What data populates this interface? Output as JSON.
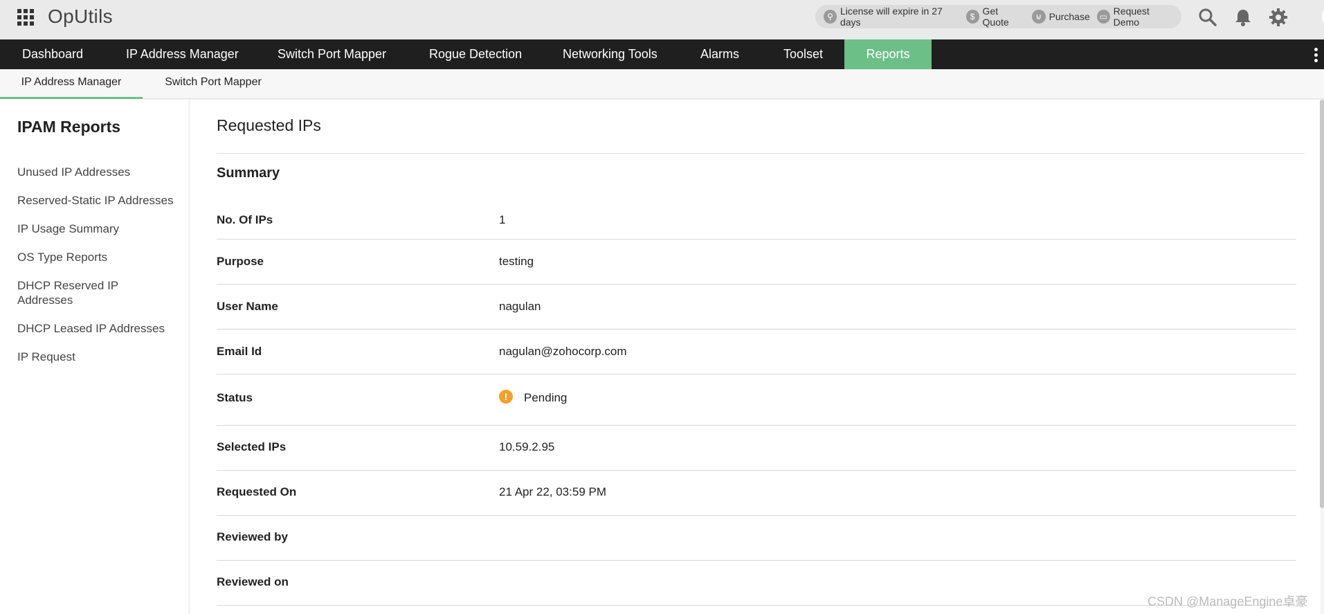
{
  "header": {
    "app_title": "OpUtils",
    "license_text": "License will expire in 27 days",
    "get_quote": "Get Quote",
    "purchase": "Purchase",
    "request_demo": "Request Demo"
  },
  "nav": {
    "items": [
      "Dashboard",
      "IP Address Manager",
      "Switch Port Mapper",
      "Rogue Detection",
      "Networking Tools",
      "Alarms",
      "Toolset",
      "Reports"
    ],
    "active": "Reports",
    "accent_color": "#6bbf87"
  },
  "subtabs": {
    "items": [
      "IP Address Manager",
      "Switch Port Mapper"
    ],
    "active": "IP Address Manager"
  },
  "sidebar": {
    "title": "IPAM Reports",
    "items": [
      "Unused IP Addresses",
      "Reserved-Static IP Addresses",
      "IP Usage Summary",
      "OS Type Reports",
      "DHCP Reserved IP Addresses",
      "DHCP Leased IP Addresses",
      "IP Request"
    ]
  },
  "main": {
    "page_title": "Requested IPs",
    "section_title": "Summary",
    "rows": [
      {
        "label": "No. Of IPs",
        "value": "1"
      },
      {
        "label": "Purpose",
        "value": "testing"
      },
      {
        "label": "User Name",
        "value": "nagulan"
      },
      {
        "label": "Email Id",
        "value": "nagulan@zohocorp.com"
      },
      {
        "label": "Status",
        "value": "Pending",
        "status_icon": "warning-icon",
        "status_color": "#f0a030"
      },
      {
        "label": "Selected IPs",
        "value": "10.59.2.95"
      },
      {
        "label": "Requested On",
        "value": "21 Apr 22, 03:59 PM"
      },
      {
        "label": "Reviewed by",
        "value": ""
      },
      {
        "label": "Reviewed on",
        "value": ""
      }
    ]
  },
  "watermark": "CSDN @ManageEngine卓豪"
}
